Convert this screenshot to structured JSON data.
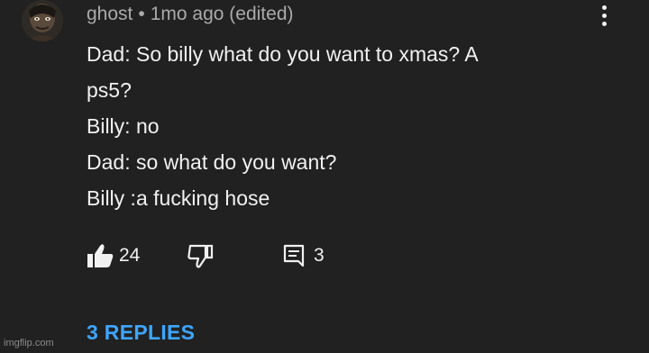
{
  "comment": {
    "author": "ghost",
    "separator": "•",
    "timestamp": "1mo ago (edited)",
    "lines": [
      "Dad: So billy what do you want to xmas? A",
      "ps5?",
      "Billy: no",
      "Dad: so what do you want?",
      "Billy :a fucking hose"
    ]
  },
  "actions": {
    "like_icon": "thumbs-up-icon",
    "like_count": "24",
    "dislike_icon": "thumbs-down-icon",
    "reply_icon": "comment-reply-icon",
    "reply_count": "3"
  },
  "replies_label": "3 REPLIES",
  "menu_icon": "more-vertical-icon",
  "watermark": "imgflip.com",
  "colors": {
    "background": "#212121",
    "text": "#f1f1f1",
    "meta": "#aaaaaa",
    "link": "#3ea6ff"
  }
}
